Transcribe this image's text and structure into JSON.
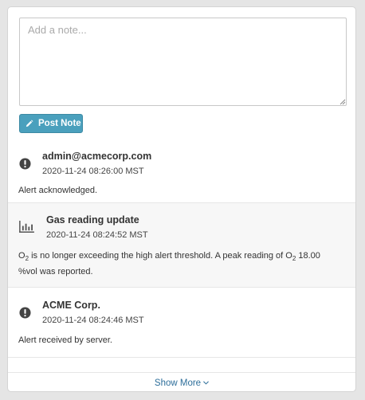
{
  "note_form": {
    "placeholder": "Add a note...",
    "value": "",
    "post_label": "Post Note"
  },
  "timeline": [
    {
      "icon": "exclamation-circle-icon",
      "title": "admin@acmecorp.com",
      "timestamp": "2020-11-24 08:26:00 MST",
      "message": "Alert acknowledged."
    },
    {
      "icon": "bar-chart-icon",
      "title": "Gas reading update",
      "timestamp": "2020-11-24 08:24:52 MST",
      "message_parts": {
        "gas_a": "O",
        "sub_a": "2",
        "mid": " is no longer exceeding the high alert threshold. A peak reading of O",
        "sub_b": "2",
        "tail": " 18.00 %vol was reported."
      }
    },
    {
      "icon": "exclamation-circle-icon",
      "title": "ACME Corp.",
      "timestamp": "2020-11-24 08:24:46 MST",
      "message": "Alert received by server."
    }
  ],
  "footer": {
    "show_more_label": "Show More"
  },
  "colors": {
    "button": "#4aa0bd",
    "link": "#2d6e9a",
    "shaded_row": "#f7f7f7"
  }
}
